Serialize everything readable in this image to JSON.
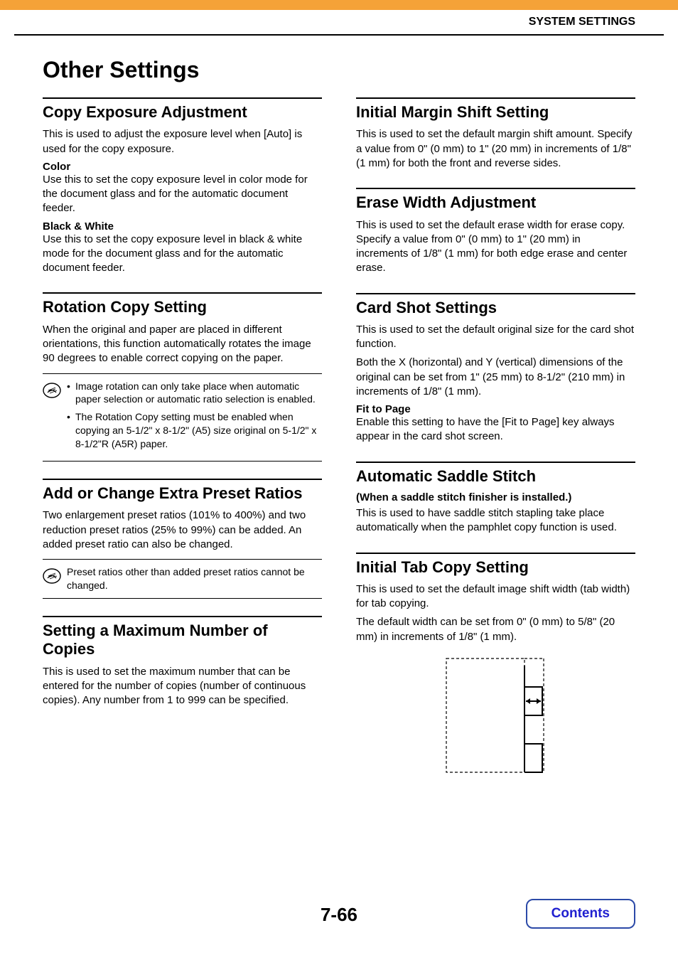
{
  "header": {
    "title": "SYSTEM SETTINGS"
  },
  "page": {
    "title": "Other Settings",
    "number": "7-66"
  },
  "left": {
    "s1": {
      "heading": "Copy Exposure Adjustment",
      "body": "This is used to adjust the exposure level when [Auto] is used for the copy exposure.",
      "sub1_title": "Color",
      "sub1_body": "Use this to set the copy exposure level in color mode for the document glass and for the automatic document feeder.",
      "sub2_title": "Black & White",
      "sub2_body": "Use this to set the copy exposure level in black & white mode for the document glass and for the automatic document feeder."
    },
    "s2": {
      "heading": "Rotation Copy Setting",
      "body": "When the original and paper are placed in different orientations, this function automatically rotates the image 90 degrees to enable correct copying on the paper.",
      "note_b1": "Image rotation can only take place when automatic paper selection or automatic ratio selection is enabled.",
      "note_b2": "The Rotation Copy setting must be enabled when copying an 5-1/2\" x 8-1/2\" (A5) size original on 5-1/2\" x 8-1/2\"R (A5R) paper."
    },
    "s3": {
      "heading": "Add or Change Extra Preset Ratios",
      "body": "Two enlargement preset ratios (101% to 400%) and two reduction preset ratios (25% to 99%) can be added. An added preset ratio can also be changed.",
      "note": "Preset ratios other than added preset ratios cannot be changed."
    },
    "s4": {
      "heading": "Setting a Maximum Number of Copies",
      "body": "This is used to set the maximum number that can be entered for the number of copies (number of continuous copies). Any number from 1 to 999 can be specified."
    }
  },
  "right": {
    "s1": {
      "heading": "Initial Margin Shift Setting",
      "body": "This is used to set the default margin shift amount. Specify a value from 0\" (0 mm) to 1\" (20 mm) in increments of 1/8\" (1 mm) for both the front and reverse sides."
    },
    "s2": {
      "heading": "Erase Width Adjustment",
      "body": "This is used to set the default erase width for erase copy. Specify a value from 0\" (0 mm) to 1\" (20 mm) in increments of 1/8\" (1 mm) for both edge erase and center erase."
    },
    "s3": {
      "heading": "Card Shot Settings",
      "body1": "This is used to set the default original size for the card shot function.",
      "body2": "Both the X (horizontal) and Y (vertical) dimensions of the original can be set from 1\" (25 mm) to 8-1/2\" (210 mm) in increments of 1/8\" (1 mm).",
      "sub_title": "Fit to Page",
      "sub_body": "Enable this setting to have the [Fit to Page] key always appear in the card shot screen."
    },
    "s4": {
      "heading": "Automatic Saddle Stitch",
      "subheading": "(When a saddle stitch finisher is installed.)",
      "body": "This is used to have saddle stitch stapling take place automatically when the pamphlet copy function is used."
    },
    "s5": {
      "heading": "Initial Tab Copy Setting",
      "body1": "This is used to set the default image shift width (tab width) for tab copying.",
      "body2": "The default width can be set from 0\" (0 mm) to 5/8\" (20 mm) in increments of 1/8\" (1 mm)."
    }
  },
  "footer": {
    "contents": "Contents"
  }
}
